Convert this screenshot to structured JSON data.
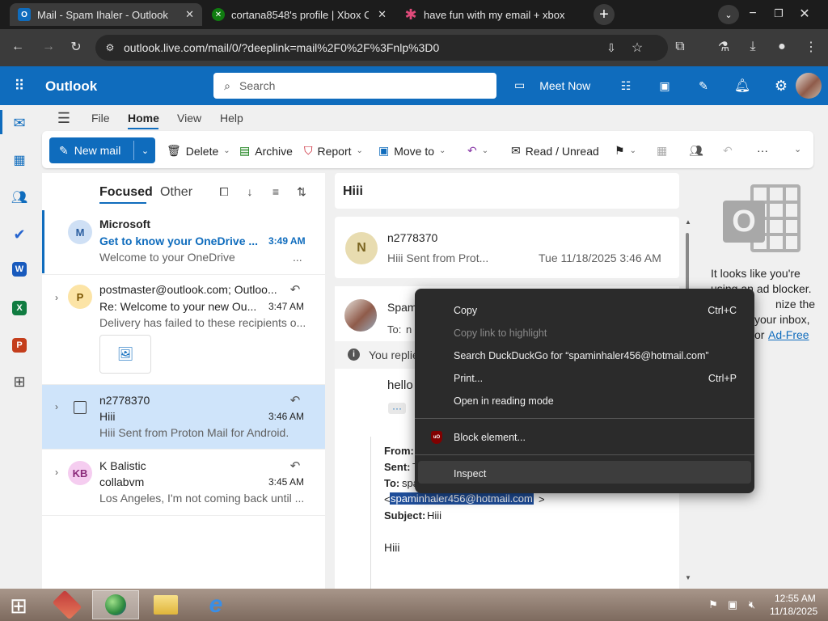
{
  "browser": {
    "tabs": [
      {
        "title": "Mail - Spam Ihaler - Outlook",
        "active": true
      },
      {
        "title": "cortana8548's profile | Xbox Clo",
        "active": false
      },
      {
        "title": "have fun with my email + xbox",
        "active": false
      }
    ],
    "url": "outlook.live.com/mail/0/?deeplink=mail%2F0%2F%3Fnlp%3D0"
  },
  "outlook": {
    "app_name": "Outlook",
    "search_placeholder": "Search",
    "meet_now": "Meet Now",
    "menu_tabs": [
      "File",
      "Home",
      "View",
      "Help"
    ],
    "ribbon": {
      "new_mail": "New mail",
      "delete": "Delete",
      "archive": "Archive",
      "report": "Report",
      "move_to": "Move to",
      "read_unread": "Read / Unread",
      "more": "···"
    },
    "list_tabs": {
      "focused": "Focused",
      "other": "Other"
    },
    "messages": [
      {
        "avatar": "M",
        "avatar_color": "#cfe0f5",
        "sender": "Microsoft",
        "subject": "Get to know your OneDrive ...",
        "time": "3:49 AM",
        "preview": "Welcome to your OneDrive",
        "more": "...",
        "unread": true
      },
      {
        "avatar": "P",
        "avatar_color": "#fce4a6",
        "sender": "postmaster@outlook.com; Outloo...",
        "subject": "Re: Welcome to your new Ou...",
        "time": "3:47 AM",
        "preview": "Delivery has failed to these recipients o..."
      },
      {
        "avatar": "",
        "sender": "n2778370",
        "subject": "Hiii",
        "time": "3:46 AM",
        "preview": "Hiii Sent from Proton Mail for Android.",
        "selected": true
      },
      {
        "avatar": "KB",
        "avatar_color": "#f5cdf0",
        "sender": "K Balistic",
        "subject": "collabvm",
        "time": "3:45 AM",
        "preview": "Los Angeles, I'm not coming back until ..."
      }
    ],
    "reading": {
      "subject": "Hiii",
      "card1": {
        "avatar": "N",
        "sender": "n2778370",
        "preview": "Hiii Sent from Prot...",
        "date": "Tue 11/18/2025 3:46 AM"
      },
      "card2": {
        "sender": "Spam",
        "to_label": "To:",
        "to_value": "n",
        "info": "You replie",
        "greeting": "hello",
        "ellipsis": "···",
        "quoted": {
          "from_label": "From:",
          "sent_label": "Sent:",
          "sent_value": "T",
          "to_label": "To:",
          "to_value": "spa",
          "email_open": "<",
          "email": "spaminhaler456@hotmail.com",
          "email_close": ">",
          "subject_label": "Subject:",
          "subject_value": "Hiii"
        },
        "body": "Hiii"
      }
    },
    "ad_pane": {
      "lines": [
        "It looks like you're",
        "using an ad blocker.",
        "nize the",
        "your inbox,",
        "or"
      ],
      "link": "Ad-Free"
    }
  },
  "context_menu": {
    "items": [
      {
        "label": "Copy",
        "shortcut": "Ctrl+C",
        "disabled": false
      },
      {
        "label": "Copy link to highlight",
        "shortcut": "",
        "disabled": true
      },
      {
        "label": "Search DuckDuckGo for “spaminhaler456@hotmail.com”",
        "shortcut": "",
        "disabled": false
      },
      {
        "label": "Print...",
        "shortcut": "Ctrl+P",
        "disabled": false
      },
      {
        "label": "Open in reading mode",
        "shortcut": "",
        "disabled": false
      },
      {
        "label": "Block element...",
        "shortcut": "",
        "disabled": false
      },
      {
        "label": "Inspect",
        "shortcut": "",
        "disabled": false
      }
    ]
  },
  "taskbar": {
    "time": "12:55 AM",
    "date": "11/18/2025"
  }
}
